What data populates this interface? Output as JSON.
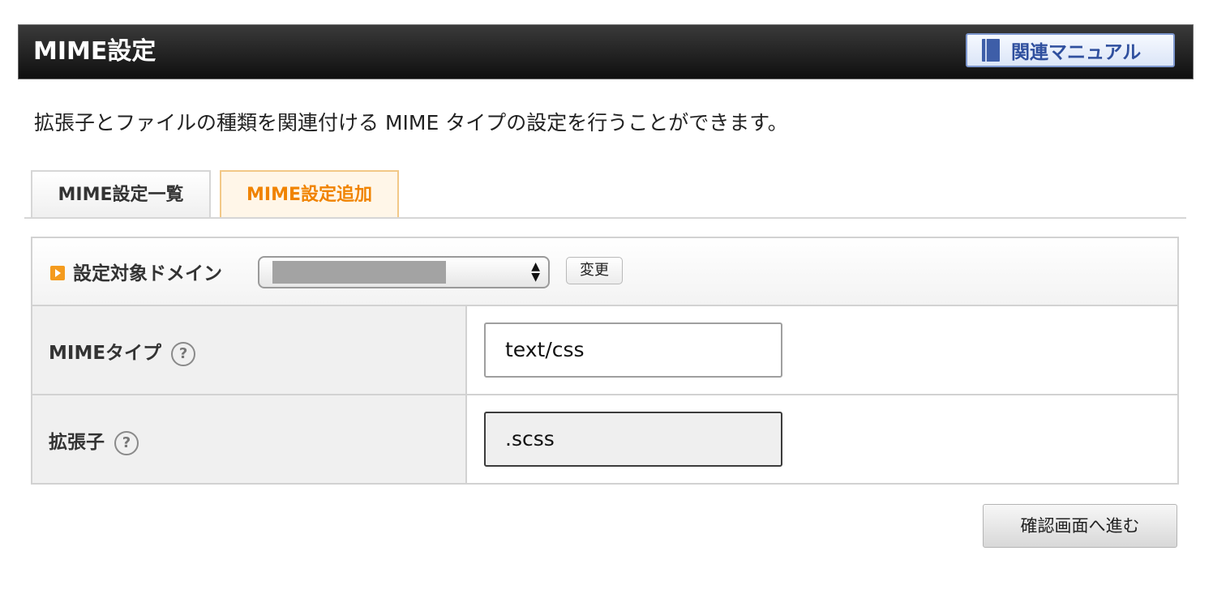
{
  "header": {
    "title": "MIME設定",
    "manual_button_label": "関連マニュアル",
    "manual_icon": "book-icon"
  },
  "description": "拡張子とファイルの種類を関連付ける MIME タイプの設定を行うことができます。",
  "tabs": [
    {
      "label": "MIME設定一覧",
      "active": false
    },
    {
      "label": "MIME設定追加",
      "active": true
    }
  ],
  "domain": {
    "label": "設定対象ドメイン",
    "marker_icon": "orange-arrow-icon",
    "select_icon": "up-down-arrows-icon",
    "change_button_label": "変更"
  },
  "form": {
    "mime_type": {
      "label": "MIMEタイプ",
      "help": "?",
      "value": "text/css"
    },
    "extension": {
      "label": "拡張子",
      "help": "?",
      "value": ".scss"
    }
  },
  "confirm_button_label": "確認画面へ進む",
  "colors": {
    "header_bg": "#1a1a1a",
    "active_tab_text": "#f08300",
    "manual_button_text": "#2f4f9e",
    "marker": "#f49b1e"
  }
}
